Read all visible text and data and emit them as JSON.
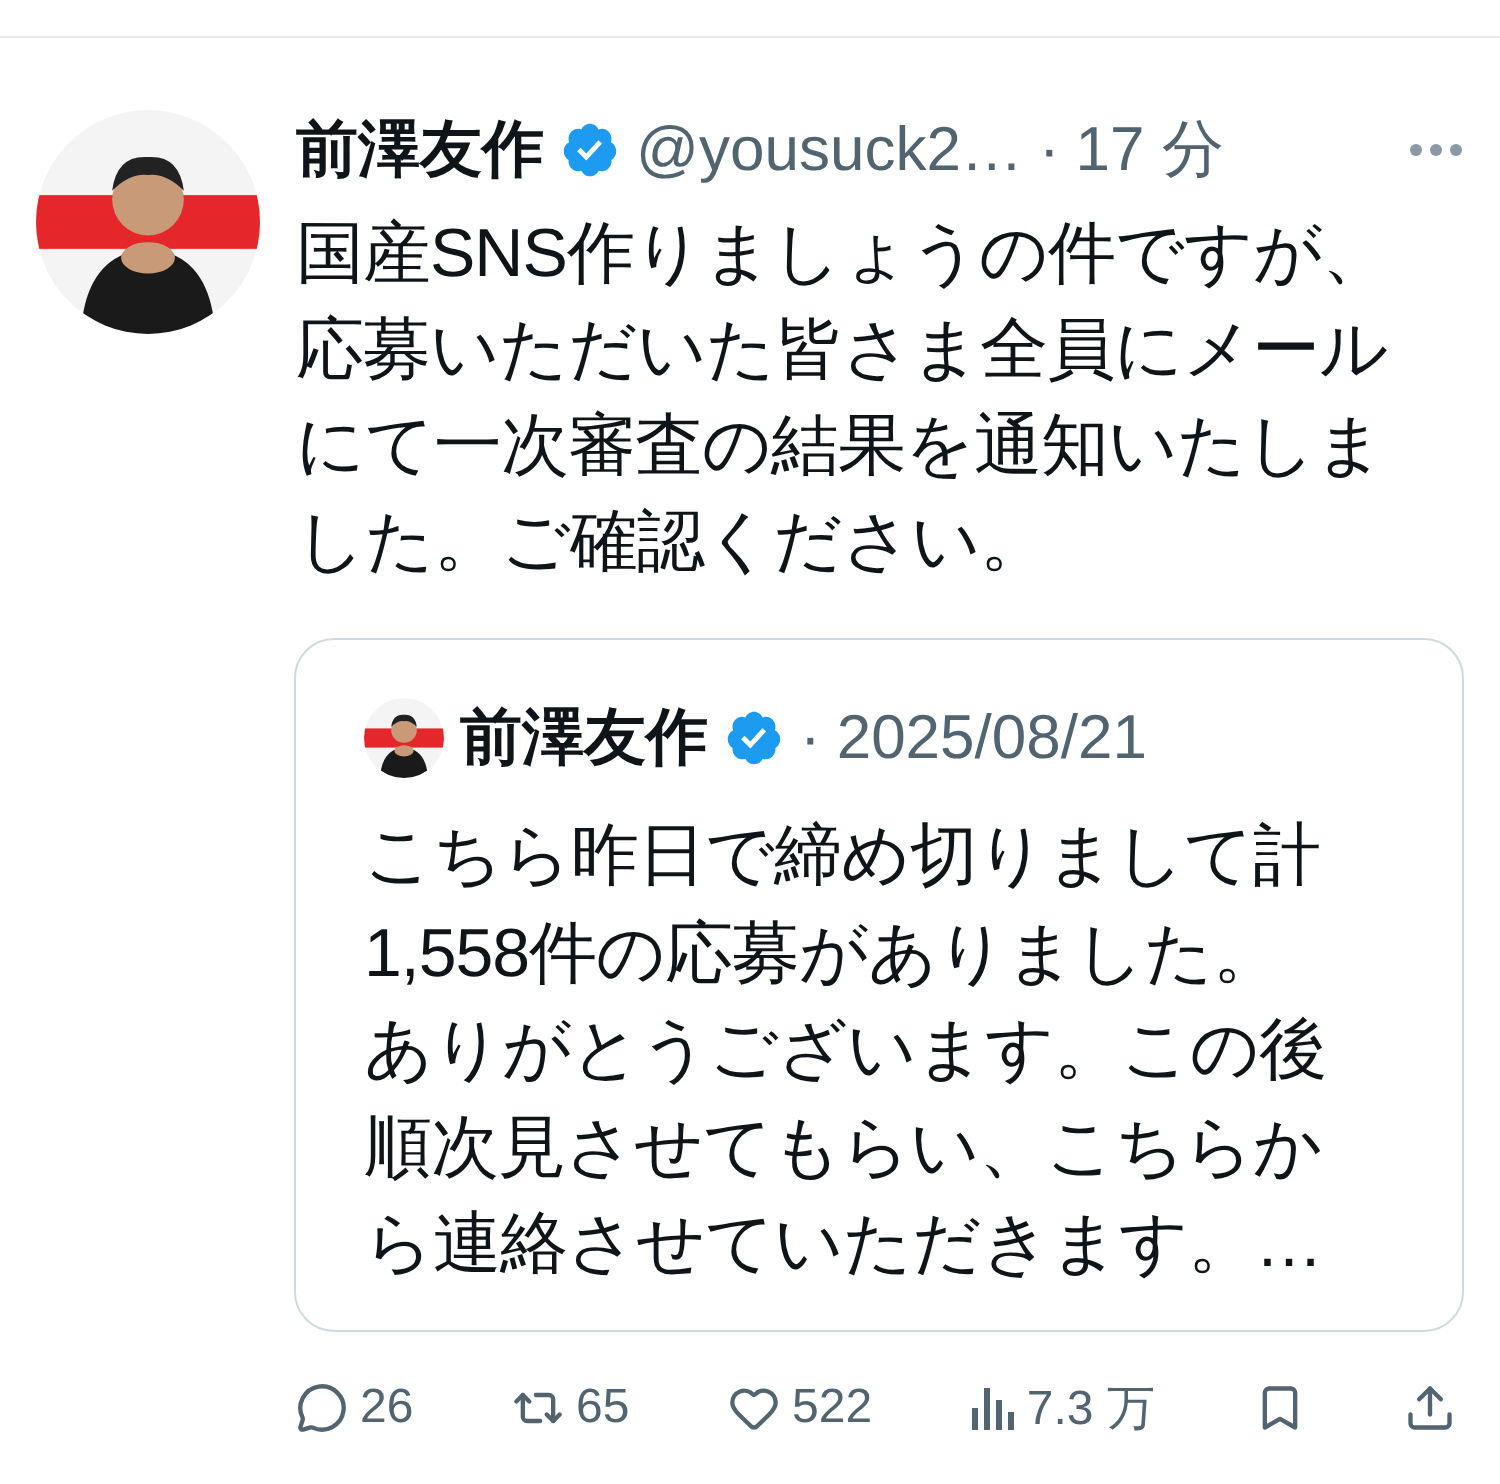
{
  "tweet": {
    "author": {
      "name": "前澤友作",
      "verified": true,
      "handle": "@yousuck2…",
      "separator": "·",
      "time": "17 分"
    },
    "text": "国産SNS作りましょうの件ですが、応募いただいた皆さま全員にメールにて一次審査の結果を通知いたしました。ご確認ください。",
    "quote": {
      "author": {
        "name": "前澤友作",
        "verified": true,
        "separator": "·",
        "date": "2025/08/21"
      },
      "text": "こちら昨日で締め切りまして計1,558件の応募がありました。ありがとうございます。この後順次見させてもらい、こちらから連絡させていただきます。…"
    },
    "actions": [
      {
        "kind": "reply",
        "count": "26"
      },
      {
        "kind": "repost",
        "count": "65"
      },
      {
        "kind": "like",
        "count": "522"
      },
      {
        "kind": "views",
        "count": "7.3 万"
      },
      {
        "kind": "bookmark"
      },
      {
        "kind": "share"
      }
    ]
  }
}
